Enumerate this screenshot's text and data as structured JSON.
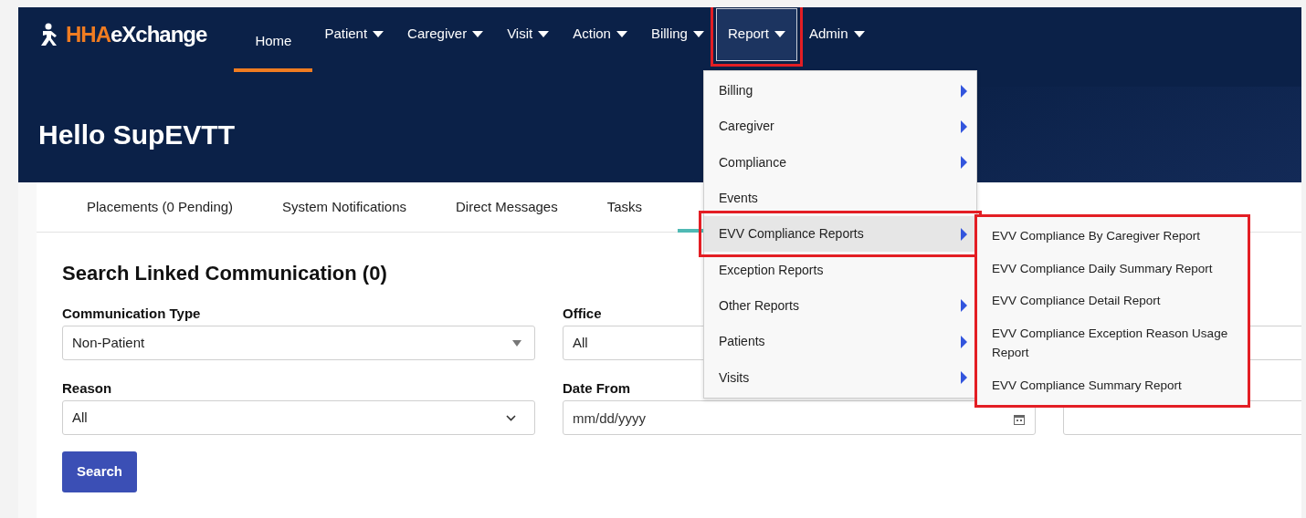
{
  "brand": {
    "prefix": "HHA",
    "suffix": "eXchange"
  },
  "nav": [
    {
      "label": "Home",
      "has_menu": false,
      "selected": true,
      "open": false,
      "highlighted": false
    },
    {
      "label": "Patient",
      "has_menu": true,
      "selected": false,
      "open": false,
      "highlighted": false
    },
    {
      "label": "Caregiver",
      "has_menu": true,
      "selected": false,
      "open": false,
      "highlighted": false
    },
    {
      "label": "Visit",
      "has_menu": true,
      "selected": false,
      "open": false,
      "highlighted": false
    },
    {
      "label": "Action",
      "has_menu": true,
      "selected": false,
      "open": false,
      "highlighted": false
    },
    {
      "label": "Billing",
      "has_menu": true,
      "selected": false,
      "open": false,
      "highlighted": false
    },
    {
      "label": "Report",
      "has_menu": true,
      "selected": false,
      "open": true,
      "highlighted": true
    },
    {
      "label": "Admin",
      "has_menu": true,
      "selected": false,
      "open": false,
      "highlighted": false
    }
  ],
  "greeting": "Hello SupEVTT",
  "tabs": [
    {
      "label": "Placements (0 Pending)",
      "selected": false
    },
    {
      "label": "System Notifications",
      "selected": false
    },
    {
      "label": "Direct Messages",
      "selected": false
    },
    {
      "label": "Tasks",
      "selected": false
    }
  ],
  "section_title": "Search Linked Communication (0)",
  "fields": [
    {
      "kind": "dropdown",
      "label": "Communication Type",
      "value": "Non-Patient"
    },
    {
      "kind": "plain",
      "label": "Office",
      "value": "All"
    },
    {
      "kind": "blank"
    },
    {
      "kind": "chevron",
      "label": "Reason",
      "value": "All"
    },
    {
      "kind": "date",
      "label": "Date From",
      "placeholder": "mm/dd/yyyy"
    },
    {
      "kind": "blank"
    }
  ],
  "search_button": "Search",
  "report_menu": [
    {
      "label": "Billing",
      "has_submenu": true,
      "selected": false,
      "highlighted": false
    },
    {
      "label": "Caregiver",
      "has_submenu": true,
      "selected": false,
      "highlighted": false
    },
    {
      "label": "Compliance",
      "has_submenu": true,
      "selected": false,
      "highlighted": false
    },
    {
      "label": "Events",
      "has_submenu": false,
      "selected": false,
      "highlighted": false
    },
    {
      "label": "EVV Compliance Reports",
      "has_submenu": true,
      "selected": true,
      "highlighted": true
    },
    {
      "label": "Exception Reports",
      "has_submenu": false,
      "selected": false,
      "highlighted": false
    },
    {
      "label": "Other Reports",
      "has_submenu": true,
      "selected": false,
      "highlighted": false
    },
    {
      "label": "Patients",
      "has_submenu": true,
      "selected": false,
      "highlighted": false
    },
    {
      "label": "Visits",
      "has_submenu": true,
      "selected": false,
      "highlighted": false
    }
  ],
  "submenu": {
    "highlighted": true,
    "items": [
      "EVV Compliance By Caregiver Report",
      "EVV Compliance Daily Summary Report",
      "EVV Compliance Detail Report",
      "EVV Compliance Exception Reason Usage Report",
      "EVV Compliance Summary Report"
    ]
  }
}
